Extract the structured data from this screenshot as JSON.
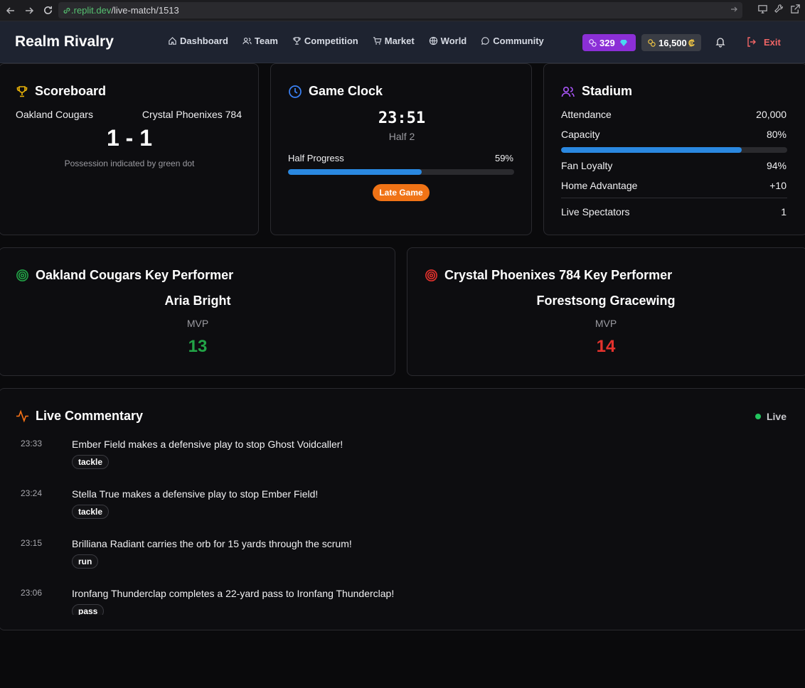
{
  "browser": {
    "url_host": ".replit.dev",
    "url_path": "/live-match/1513"
  },
  "header": {
    "brand": "Realm Rivalry",
    "nav": [
      {
        "label": "Dashboard",
        "icon": "home-icon"
      },
      {
        "label": "Team",
        "icon": "users-icon"
      },
      {
        "label": "Competition",
        "icon": "trophy-icon"
      },
      {
        "label": "Market",
        "icon": "cart-icon"
      },
      {
        "label": "World",
        "icon": "globe-icon"
      },
      {
        "label": "Community",
        "icon": "chat-icon"
      }
    ],
    "gems": "329",
    "credits": "16,500",
    "credit_symbol": "₡",
    "exit_label": "Exit"
  },
  "scoreboard": {
    "title": "Scoreboard",
    "home_team": "Oakland Cougars",
    "away_team": "Crystal Phoenixes 784",
    "score": "1 - 1",
    "note": "Possession indicated by green dot"
  },
  "clock": {
    "title": "Game Clock",
    "time": "23:51",
    "half": "Half 2",
    "progress_label": "Half Progress",
    "progress_text": "59%",
    "progress_value": 0.59,
    "phase_badge": "Late Game"
  },
  "stadium": {
    "title": "Stadium",
    "attendance_label": "Attendance",
    "attendance_value": "20,000",
    "capacity_label": "Capacity",
    "capacity_value": "80%",
    "capacity_fraction": 0.8,
    "loyalty_label": "Fan Loyalty",
    "loyalty_value": "94%",
    "advantage_label": "Home Advantage",
    "advantage_value": "+10",
    "spectators_label": "Live Spectators",
    "spectators_value": "1"
  },
  "home_performer": {
    "title": "Oakland Cougars Key Performer",
    "name": "Aria Bright",
    "role": "MVP",
    "score": "13",
    "color": "#22a447"
  },
  "away_performer": {
    "title": "Crystal Phoenixes 784 Key Performer",
    "name": "Forestsong Gracewing",
    "role": "MVP",
    "score": "14",
    "color": "#e5322d"
  },
  "commentary": {
    "title": "Live Commentary",
    "live_label": "Live",
    "events": [
      {
        "time": "23:33",
        "text": "Ember Field makes a defensive play to stop Ghost Voidcaller!",
        "tag": "tackle"
      },
      {
        "time": "23:24",
        "text": "Stella True makes a defensive play to stop Ember Field!",
        "tag": "tackle"
      },
      {
        "time": "23:15",
        "text": "Brilliana Radiant carries the orb for 15 yards through the scrum!",
        "tag": "run"
      },
      {
        "time": "23:06",
        "text": "Ironfang Thunderclap completes a 22-yard pass to Ironfang Thunderclap!",
        "tag": "pass"
      }
    ]
  },
  "colors": {
    "accent_blue": "#2a88e0",
    "gem_purple": "#8b2fd6",
    "orange": "#f07316",
    "live_green": "#22c55e"
  }
}
